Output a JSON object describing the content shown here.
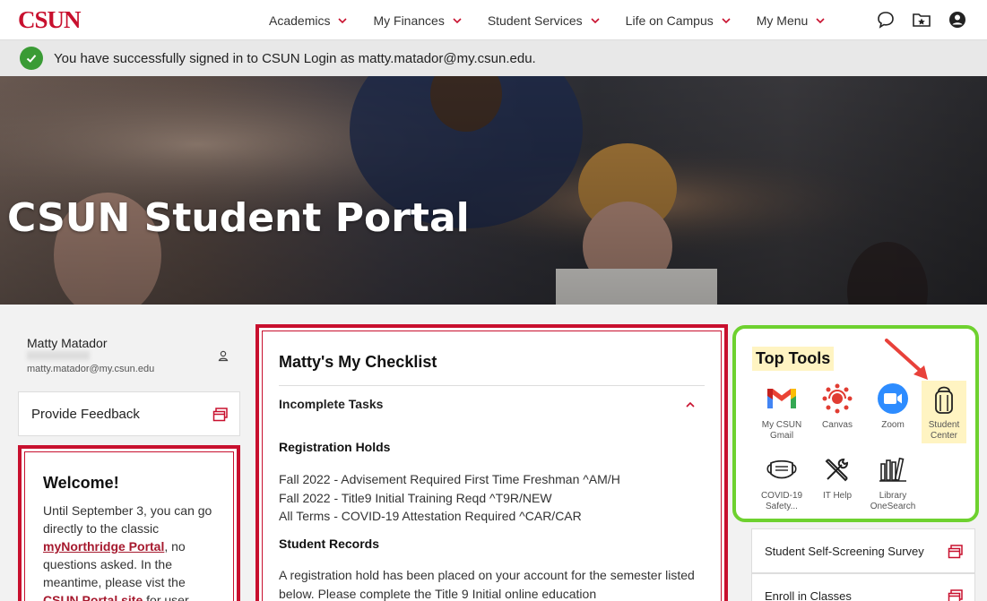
{
  "nav": {
    "logo": "CSUN",
    "items": [
      {
        "label": "Academics"
      },
      {
        "label": "My Finances"
      },
      {
        "label": "Student Services"
      },
      {
        "label": "Life on Campus"
      },
      {
        "label": "My Menu"
      }
    ],
    "icons": [
      "chat-icon",
      "star-folder-icon",
      "user-account-icon"
    ]
  },
  "banner": {
    "text": "You have successfully signed in to CSUN Login as matty.matador@my.csun.edu."
  },
  "hero": {
    "title": "CSUN Student Portal"
  },
  "profile": {
    "name": "Matty Matador",
    "email": "matty.matador@my.csun.edu"
  },
  "feedback": {
    "label": "Provide Feedback"
  },
  "welcome": {
    "heading": "Welcome!",
    "text1": "Until September 3, you can go directly to the classic ",
    "link1": "myNorthridge Portal",
    "text2": ", no questions asked. In the meantime, please vist the ",
    "link2": "CSUN Portal site",
    "text3": " for user"
  },
  "checklist": {
    "title": "Matty's My Checklist",
    "section_label": "Incomplete Tasks",
    "registration_holds": "Registration Holds",
    "holds": [
      "Fall 2022 - Advisement Required First Time Freshman ^AM/H",
      "Fall 2022 - Title9 Initial Training Reqd ^T9R/NEW",
      "All Terms - COVID-19 Attestation Required ^CAR/CAR"
    ],
    "student_records": "Student Records",
    "records_text": "A registration hold has been placed on your account for the semester listed below. Please complete the Title 9 Initial online education"
  },
  "tools": {
    "title": "Top Tools",
    "items": [
      {
        "label": "My CSUN Gmail",
        "icon": "gmail-icon"
      },
      {
        "label": "Canvas",
        "icon": "canvas-icon"
      },
      {
        "label": "Zoom",
        "icon": "zoom-icon"
      },
      {
        "label": "Student Center",
        "icon": "backpack-icon"
      },
      {
        "label": "COVID-19 Safety...",
        "icon": "mask-icon"
      },
      {
        "label": "IT Help",
        "icon": "tools-icon"
      },
      {
        "label": "Library OneSearch",
        "icon": "library-icon"
      }
    ]
  },
  "links": [
    {
      "label": "Student Self-Screening Survey"
    },
    {
      "label": "Enroll in Classes"
    }
  ],
  "colors": {
    "brand": "#c8102e",
    "highlight_green": "#6ed12f",
    "highlight_yellow": "#fff4c2",
    "arrow": "#e8413a"
  }
}
